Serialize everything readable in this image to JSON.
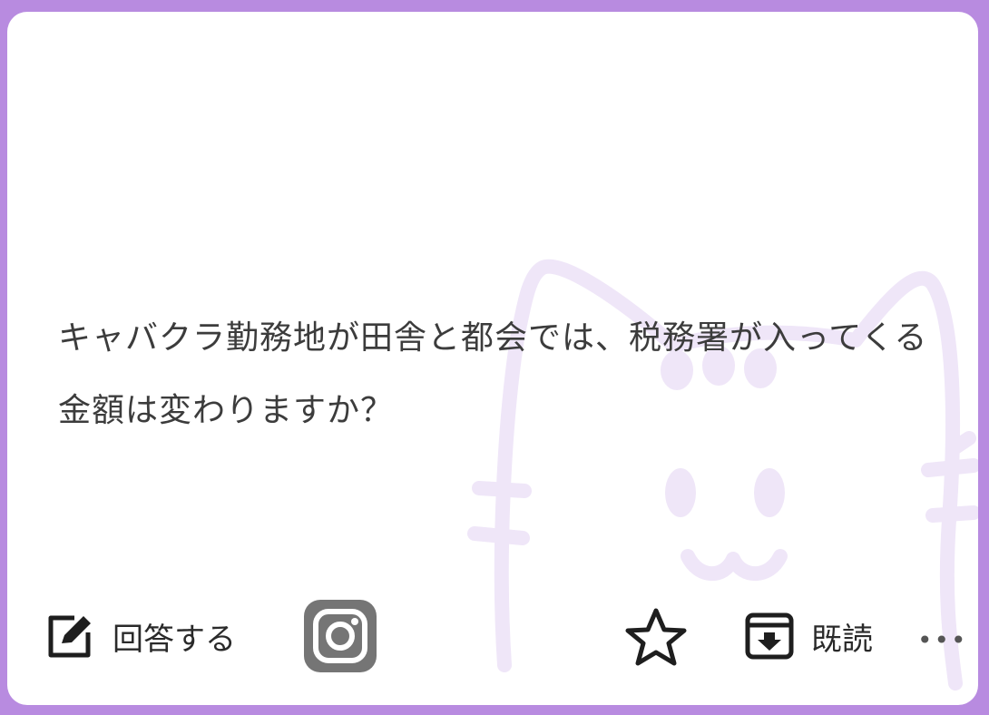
{
  "question": {
    "text": "キャバクラ勤務地が田舎と都会では、税務署が入ってくる金額は変わりますか？"
  },
  "actions": {
    "answer_label": "回答する",
    "read_label": "既読",
    "more_label": "•••"
  },
  "icons": {
    "answer": "pencil-square-icon",
    "instagram": "instagram-icon",
    "favorite": "star-icon",
    "read": "archive-download-icon",
    "more": "more-dots-icon"
  },
  "colors": {
    "frame": "#b88be0",
    "card": "#ffffff",
    "cat_watermark": "#efe6f8",
    "text": "#3c3c3c",
    "instagram_gray": "#757575"
  }
}
